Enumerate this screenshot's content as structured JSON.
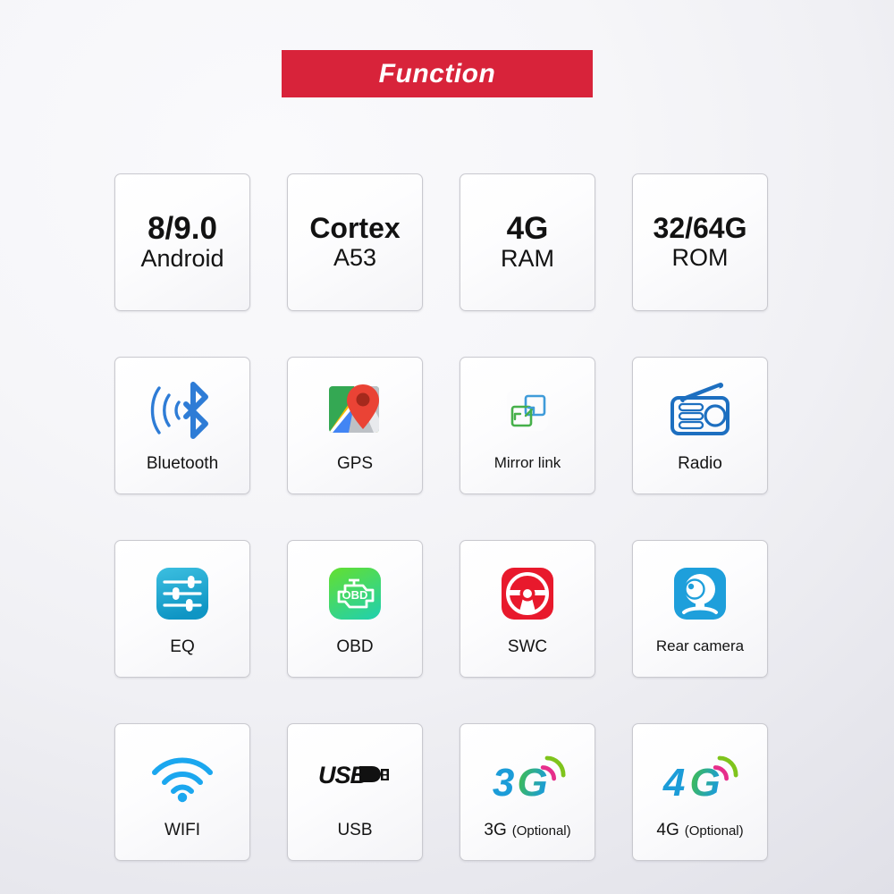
{
  "banner": {
    "title": "Function",
    "background_color": "#d8233a",
    "text_color": "#ffffff"
  },
  "page": {
    "background_from": "#fafafc",
    "background_to": "#dedee6"
  },
  "grid": {
    "columns": 4,
    "rows": 4,
    "cards": [
      {
        "id": "android",
        "type": "spec",
        "line1": "8/9.0",
        "line2": "Android",
        "icon": null
      },
      {
        "id": "cortex",
        "type": "spec",
        "line1": "Cortex",
        "line2": "A53",
        "icon": null
      },
      {
        "id": "ram",
        "type": "spec",
        "line1": "4G",
        "line2": "RAM",
        "icon": null
      },
      {
        "id": "rom",
        "type": "spec",
        "line1": "32/64G",
        "line2": "ROM",
        "icon": null
      },
      {
        "id": "bluetooth",
        "type": "icon",
        "label": "Bluetooth",
        "icon": "bluetooth-icon",
        "color": "#2e7cd6"
      },
      {
        "id": "gps",
        "type": "icon",
        "label": "GPS",
        "icon": "map-pin-icon",
        "color": "#ea4335"
      },
      {
        "id": "mirrorlink",
        "type": "icon",
        "label": "Mirror link",
        "icon": "mirror-link-icon",
        "color": "#3f9bd9"
      },
      {
        "id": "radio",
        "type": "icon",
        "label": "Radio",
        "icon": "radio-icon",
        "color": "#1d6fc0"
      },
      {
        "id": "eq",
        "type": "icon",
        "label": "EQ",
        "icon": "equalizer-icon",
        "color": "#2aa8d8"
      },
      {
        "id": "obd",
        "type": "icon",
        "label": "OBD",
        "icon": "engine-obd-icon",
        "color": "#4cd964"
      },
      {
        "id": "swc",
        "type": "icon",
        "label": "SWC",
        "icon": "steering-wheel-icon",
        "color": "#e8192c"
      },
      {
        "id": "rearcamera",
        "type": "icon",
        "label": "Rear camera",
        "icon": "webcam-icon",
        "color": "#1e9fdb"
      },
      {
        "id": "wifi",
        "type": "icon",
        "label": "WIFI",
        "icon": "wifi-icon",
        "color": "#1ba7ef"
      },
      {
        "id": "usb",
        "type": "icon",
        "label": "USB",
        "icon": "usb-icon",
        "color": "#111111"
      },
      {
        "id": "3g",
        "type": "icon",
        "label": "3G",
        "label_suffix": "(Optional)",
        "icon": "signal-3g-icon",
        "color": "#1b9cd8"
      },
      {
        "id": "4g",
        "type": "icon",
        "label": "4G",
        "label_suffix": "(Optional)",
        "icon": "signal-4g-icon",
        "color": "#1b9cd8"
      }
    ]
  },
  "icon_text": {
    "obd_label": "OBD",
    "usb_label": "USB",
    "signal_3g_digit": "3",
    "signal_3g_letter": "G",
    "signal_4g_digit": "4",
    "signal_4g_letter": "G"
  }
}
